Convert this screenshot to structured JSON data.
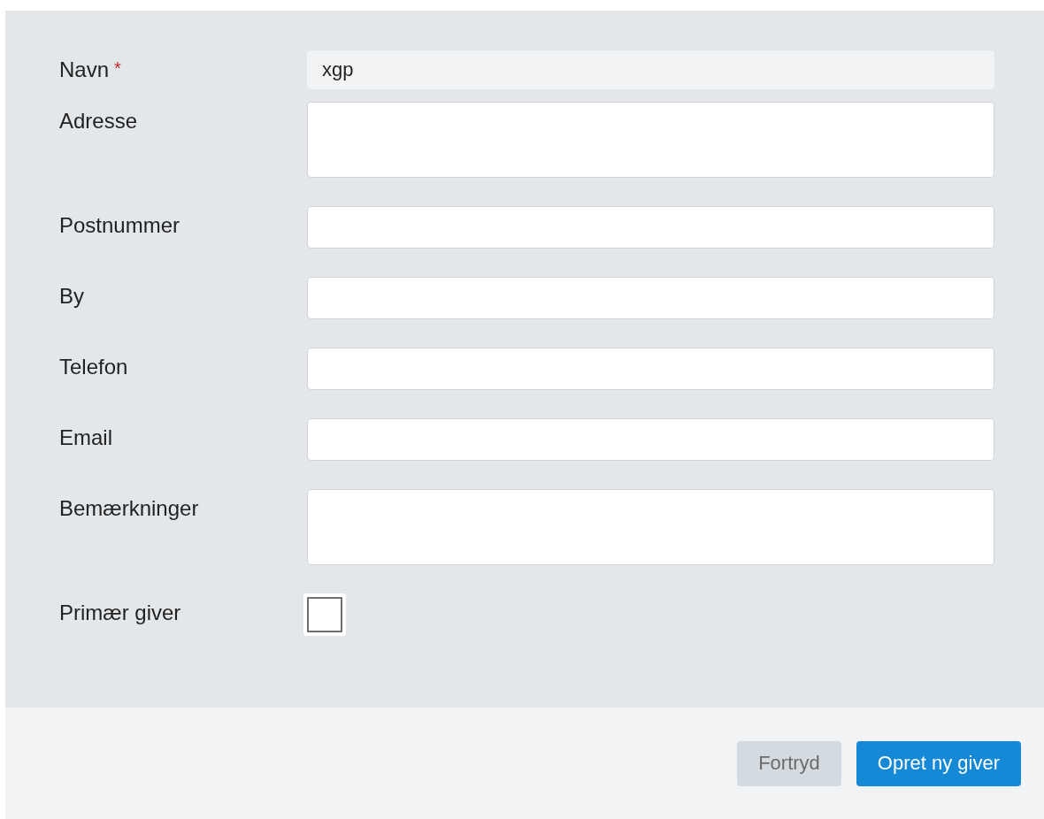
{
  "form": {
    "fields": [
      {
        "label": "Navn",
        "required_mark": "*",
        "kind": "readonly",
        "value": "xgp"
      },
      {
        "label": "Adresse",
        "kind": "textarea"
      },
      {
        "label": "Postnummer",
        "kind": "text"
      },
      {
        "label": "By",
        "kind": "text"
      },
      {
        "label": "Telefon",
        "kind": "text"
      },
      {
        "label": "Email",
        "kind": "text"
      },
      {
        "label": "Bemærkninger",
        "kind": "textarea"
      },
      {
        "label": "Primær giver",
        "kind": "checkbox",
        "checked": false
      }
    ]
  },
  "footer": {
    "buttons": [
      {
        "label": "Fortryd",
        "kind": "secondary"
      },
      {
        "label": "Opret ny giver",
        "kind": "primary"
      }
    ]
  }
}
